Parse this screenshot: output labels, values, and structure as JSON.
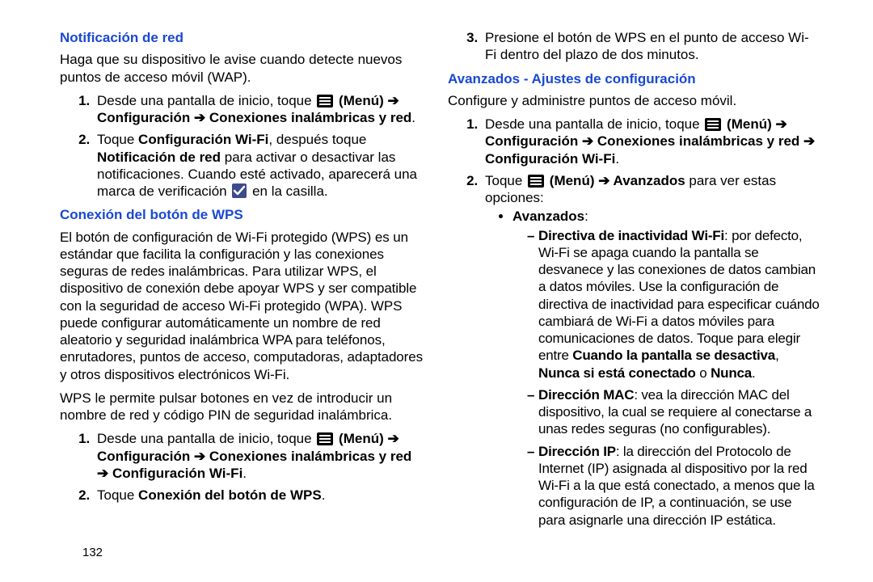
{
  "page_number": "132",
  "left": {
    "sec1": {
      "heading": "Notificación de red",
      "intro": "Haga que su dispositivo le avise cuando detecte nuevos puntos de acceso móvil (WAP).",
      "step1_a": "Desde una pantalla de inicio, toque ",
      "step1_b": " (Menú) ➔ Configuración ➔ Conexiones inalámbricas y red",
      "step1_c": ".",
      "step2_a": "Toque ",
      "step2_b": "Configuración Wi-Fi",
      "step2_c": ", después toque ",
      "step2_d": "Notificación de red",
      "step2_e": " para activar o desactivar las notificaciones. Cuando esté activado, aparecerá una marca de verificación ",
      "step2_f": " en la casilla."
    },
    "sec2": {
      "heading": "Conexión del botón de WPS",
      "para1": "El botón de configuración de Wi-Fi protegido (WPS) es un estándar que facilita la configuración y las conexiones seguras de redes inalámbricas. Para utilizar WPS, el dispositivo de conexión debe apoyar WPS y ser compatible con la seguridad de acceso Wi-Fi protegido (WPA). WPS puede configurar automáticamente un nombre de red aleatorio y seguridad inalámbrica WPA para teléfonos, enrutadores, puntos de acceso, computadoras, adaptadores y otros dispositivos electrónicos Wi-Fi.",
      "para2": "WPS le permite pulsar botones en vez de introducir un nombre de red y código PIN de seguridad inalámbrica.",
      "step1_a": "Desde una pantalla de inicio, toque ",
      "step1_b": " (Menú) ➔ Configuración ➔ Conexiones inalámbricas y red ➔ Configuración Wi-Fi",
      "step1_c": ".",
      "step2_a": "Toque ",
      "step2_b": "Conexión del botón de WPS",
      "step2_c": "."
    }
  },
  "right": {
    "step3": "Presione el botón de WPS en el punto de acceso Wi-Fi dentro del plazo de dos minutos.",
    "sec3": {
      "heading": "Avanzados - Ajustes de configuración",
      "intro": "Configure y administre puntos de acceso móvil.",
      "step1_a": "Desde una pantalla de inicio, toque ",
      "step1_b": " (Menú) ➔ Configuración ➔ Conexiones inalámbricas y red ➔ Configuración Wi-Fi",
      "step1_c": ".",
      "step2_a": "Toque ",
      "step2_b": " (Menú) ➔ Avanzados",
      "step2_c": " para ver estas opciones:",
      "bullet_label": "Avanzados",
      "bullet_colon": ":",
      "d1_a": "Directiva de inactividad Wi-Fi",
      "d1_b": ": por defecto, Wi-Fi se apaga cuando la pantalla se desvanece y las conexiones de datos cambian a datos móviles. Use la configuración de directiva de inactividad para especificar cuándo cambiará de Wi-Fi a datos móviles para comunicaciones de datos. Toque para elegir entre ",
      "d1_c": "Cuando la pantalla se desactiva",
      "d1_d": ", ",
      "d1_e": "Nunca si está conectado",
      "d1_f": " o ",
      "d1_g": "Nunca",
      "d1_h": ".",
      "d2_a": "Dirección MAC",
      "d2_b": ": vea la dirección MAC del dispositivo, la cual se requiere al conectarse a unas redes seguras (no configurables).",
      "d3_a": "Dirección IP",
      "d3_b": ": la dirección del Protocolo de Internet (IP) asignada al dispositivo por la red Wi-Fi a la que está conectado, a menos que la configuración de IP, a continuación, se use para asignarle una dirección IP estática."
    }
  }
}
